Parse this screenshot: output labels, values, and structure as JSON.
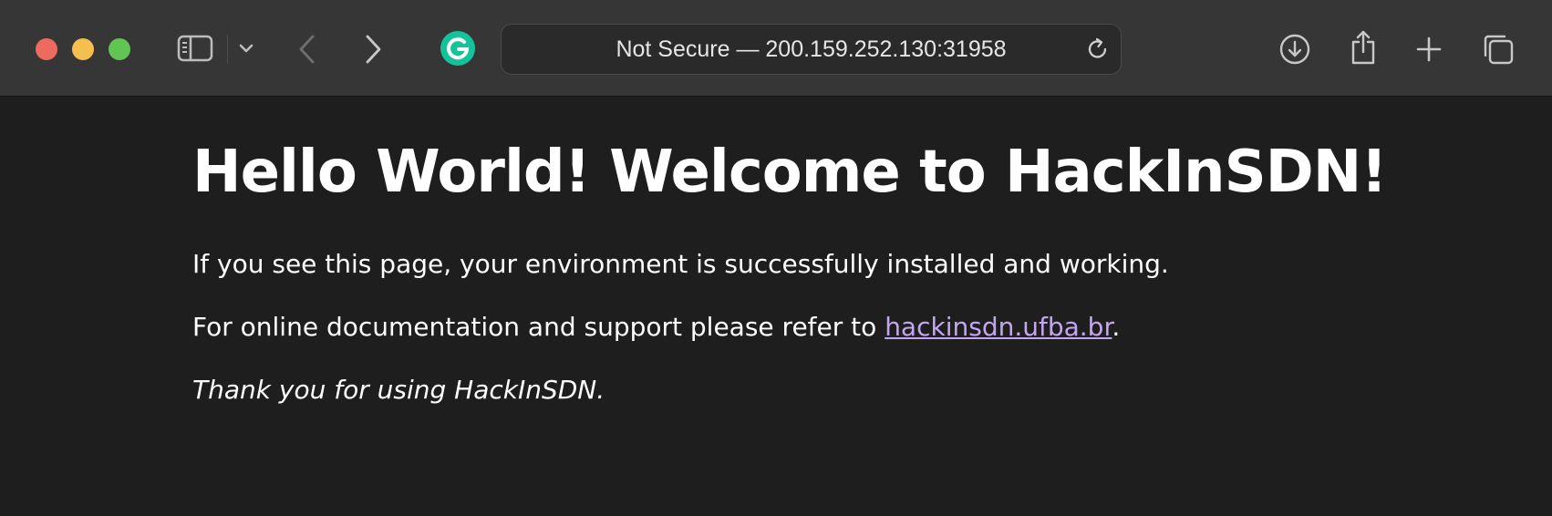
{
  "browser": {
    "address_bar": {
      "text": "Not Secure — 200.159.252.130:31958"
    },
    "icons": {
      "sidebar": "sidebar-icon",
      "tab_overview_menu": "chevron-down-icon",
      "back": "chevron-left-icon",
      "forward": "chevron-right-icon",
      "extension": "grammarly-icon",
      "reload": "reload-icon",
      "download": "download-icon",
      "share": "share-icon",
      "new_tab": "plus-icon",
      "tab_overview": "tabs-icon"
    },
    "colors": {
      "close": "#ee6a5e",
      "minimize": "#f5bf4f",
      "zoom": "#61c554",
      "grammarly": "#15c39a"
    }
  },
  "page": {
    "heading": "Hello World! Welcome to HackInSDN!",
    "line1": "If you see this page, your environment is successfully installed and working.",
    "line2_prefix": "For online documentation and support please refer to ",
    "line2_link": "hackinsdn.ufba.br",
    "line2_suffix": ".",
    "line3": "Thank you for using HackInSDN.",
    "link_color": "#c3a6ef"
  }
}
